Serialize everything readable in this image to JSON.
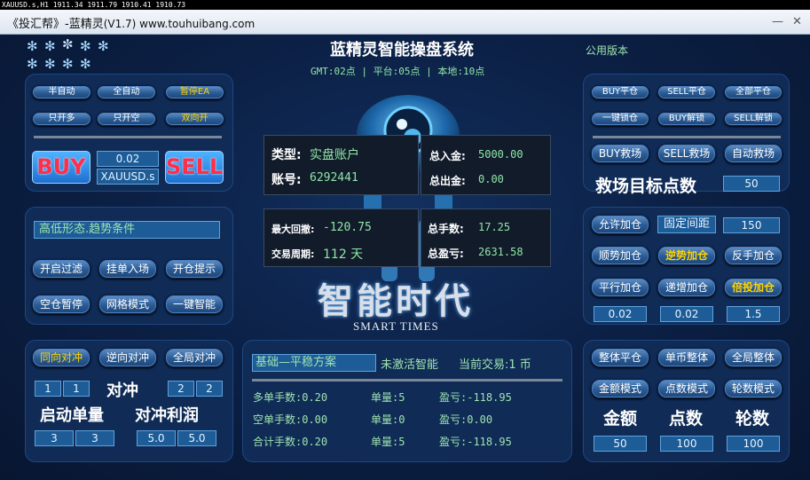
{
  "ticker": "XAUUSD.s,H1  1911.34 1911.79 1910.41 1910.73",
  "window": {
    "title_main": "《投汇帮》-蓝精灵",
    "title_ver": "(V1.7) www.touhuibang.com",
    "minimize": "—",
    "close": "✕"
  },
  "header": {
    "title": "蓝精灵智能操盘系统",
    "time_line": "GMT:02点 | 平台:05点 | 本地:10点",
    "version_label": "公用版本"
  },
  "left_top": {
    "row1": [
      "半自动",
      "全自动",
      "暂停EA"
    ],
    "row2": [
      "只开多",
      "只开空",
      "双向开"
    ],
    "buy_label": "BUY",
    "sell_label": "SELL",
    "lots_value": "0.02",
    "symbol_value": "XAUUSD.s"
  },
  "left_mid": {
    "condition_field": "高低形态.趋势条件",
    "row1": [
      "开启过滤",
      "挂单入场",
      "开仓提示"
    ],
    "row2": [
      "空仓暂停",
      "网格模式",
      "一键智能"
    ]
  },
  "left_bottom": {
    "buttons": [
      "同向对冲",
      "逆向对冲",
      "全局对冲"
    ],
    "hedge_label": "对冲",
    "hedge_left_values": [
      "1",
      "1"
    ],
    "hedge_right_values": [
      "2",
      "2"
    ],
    "start_lot_label": "启动单量",
    "hedge_profit_label": "对冲利润",
    "start_lot_values": [
      "3",
      "3"
    ],
    "hedge_profit_values": [
      "5.0",
      "5.0"
    ]
  },
  "account": {
    "type_label": "类型:",
    "type_value": "实盘账户",
    "account_label": "账号:",
    "account_value": "6292441",
    "deposit_label": "总入金:",
    "deposit_value": "5000.00",
    "withdraw_label": "总出金:",
    "withdraw_value": "0.00",
    "drawdown_label": "最大回撤:",
    "drawdown_value": "-120.75",
    "period_label": "交易周期:",
    "period_value": "112 天",
    "lots_label": "总手数:",
    "lots_value": "17.25",
    "pnl_label": "总盈亏:",
    "pnl_value": "2631.58"
  },
  "logo": {
    "cn": "智能时代",
    "en": "SMART TIMES"
  },
  "status": {
    "plan_field": "基础—平稳方案",
    "not_active": "未激活智能",
    "current_trade": "当前交易:1 币",
    "rows": [
      {
        "label": "多单手数:0.20",
        "qty": "单量:5",
        "pnl": "盈亏:-118.95"
      },
      {
        "label": "空单手数:0.00",
        "qty": "单量:0",
        "pnl": "盈亏:0.00"
      },
      {
        "label": "合计手数:0.20",
        "qty": "单量:5",
        "pnl": "盈亏:-118.95"
      }
    ]
  },
  "right_top": {
    "row1": [
      "BUY平仓",
      "SELL平仓",
      "全部平仓"
    ],
    "row2": [
      "一键锁仓",
      "BUY解锁",
      "SELL解锁"
    ],
    "row3": [
      "BUY救场",
      "SELL救场",
      "自动救场"
    ],
    "target_label": "救场目标点数",
    "target_value": "50"
  },
  "right_mid": {
    "row1_btn": "允许加仓",
    "fixed_gap_label": "固定间距",
    "gap_value": "150",
    "row2": [
      "顺势加仓",
      "逆势加仓",
      "反手加仓"
    ],
    "row3": [
      "平行加仓",
      "递增加仓",
      "倍投加仓"
    ],
    "values": [
      "0.02",
      "0.02",
      "1.5"
    ]
  },
  "right_bottom": {
    "row1": [
      "整体平仓",
      "单币整体",
      "全局整体"
    ],
    "row2": [
      "金额模式",
      "点数模式",
      "轮数模式"
    ],
    "labels": [
      "金额",
      "点数",
      "轮数"
    ],
    "values": [
      "50",
      "100",
      "100"
    ]
  }
}
